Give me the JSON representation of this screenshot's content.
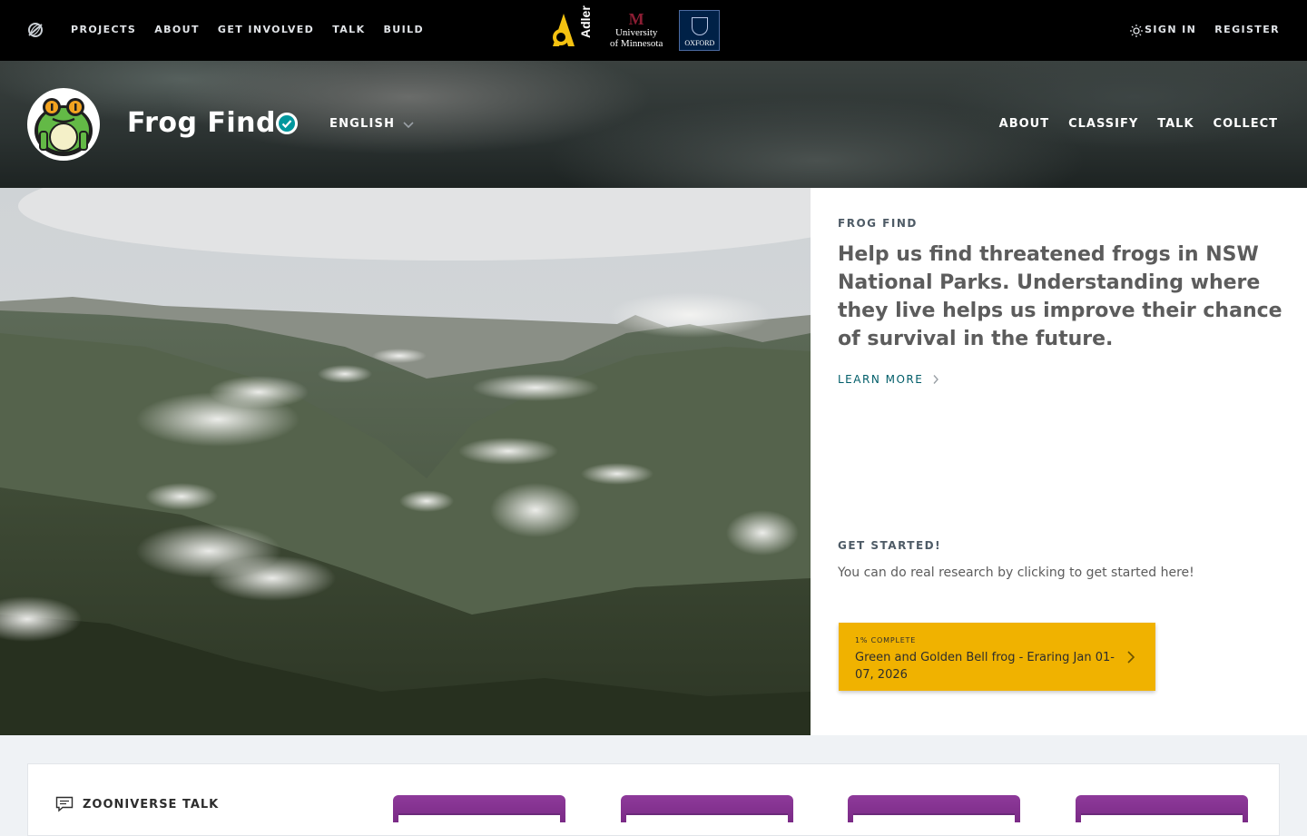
{
  "top_nav": {
    "items": [
      "PROJECTS",
      "ABOUT",
      "GET INVOLVED",
      "TALK",
      "BUILD"
    ],
    "sign_in": "SIGN IN",
    "register": "REGISTER",
    "partners": {
      "adler": "Adler",
      "umn_line1": "University",
      "umn_line2": "of Minnesota",
      "oxford": "OXFORD"
    }
  },
  "project": {
    "title": "Frog Find",
    "language": "ENGLISH",
    "nav": [
      "ABOUT",
      "CLASSIFY",
      "TALK",
      "COLLECT"
    ]
  },
  "hero": {
    "eyebrow": "FROG FIND",
    "description": "Help us find threatened frogs in NSW National Parks. Understanding where they live helps us improve their chance of survival in the future.",
    "learn_more": "LEARN MORE",
    "get_started_title": "GET STARTED!",
    "get_started_text": "You can do real research by clicking to get started here!",
    "workflow": {
      "progress": "1% COMPLETE",
      "label": "Green and Golden Bell frog - Eraring Jan 01-07, 2026"
    }
  },
  "talk": {
    "title": "ZOONIVERSE TALK"
  },
  "colors": {
    "accent": "#005d69",
    "workflow_button": "#f0b200",
    "topbar": "#000000"
  },
  "icons": [
    "zooniverse-logo-icon",
    "sun-icon",
    "verified-badge-icon",
    "chevron-down-icon",
    "chevron-right-icon",
    "chat-icon"
  ]
}
